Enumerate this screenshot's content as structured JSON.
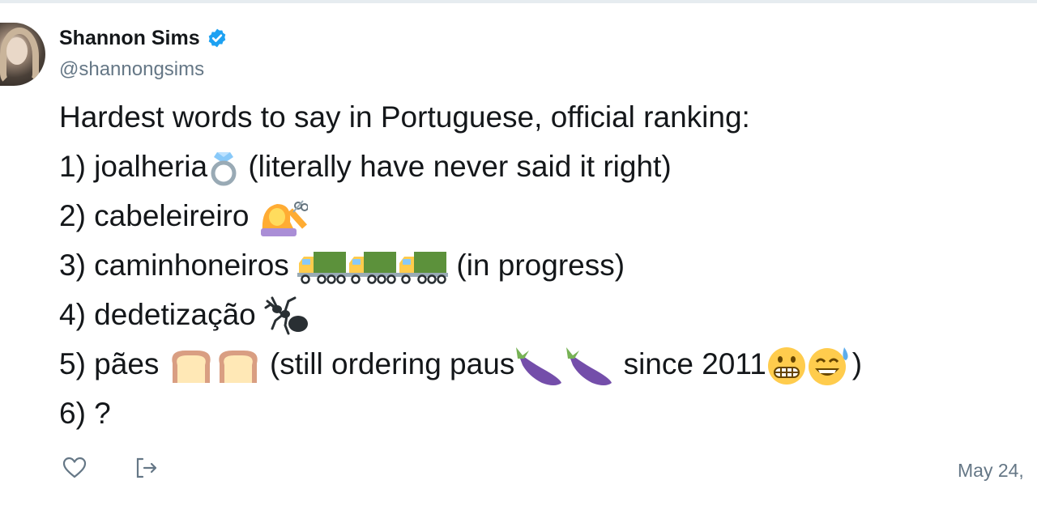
{
  "author": {
    "display_name": "Shannon Sims",
    "handle": "@shannongsims",
    "verified_icon": "verified-badge-icon",
    "avatar_icon": "profile-avatar"
  },
  "tweet": {
    "intro": "Hardest words to say in Portuguese, official ranking:",
    "items": [
      {
        "prefix": "1) joalheria",
        "suffix": " (literally have never said it right)",
        "emoji": [
          "ring-emoji"
        ]
      },
      {
        "prefix": "2) cabeleireiro ",
        "suffix": "",
        "emoji": [
          "haircut-emoji"
        ]
      },
      {
        "prefix": "3) caminhoneiros ",
        "suffix": " (in progress)",
        "emoji": [
          "truck-emoji",
          "truck-emoji",
          "truck-emoji"
        ]
      },
      {
        "prefix": "4) dedetização ",
        "suffix": "",
        "emoji": [
          "ant-emoji"
        ]
      },
      {
        "prefix": "5) pães ",
        "middle": " (still ordering paus",
        "suffix_a": " since 2011",
        "suffix": ")",
        "emoji": [
          "bread-emoji",
          "bread-emoji"
        ],
        "emoji2": [
          "eggplant-emoji",
          "eggplant-emoji"
        ],
        "emoji3": [
          "grimacing-face-emoji",
          "sweat-smile-emoji"
        ]
      },
      {
        "prefix": "6) ?",
        "suffix": "",
        "emoji": []
      }
    ]
  },
  "footer": {
    "like_icon": "heart-icon",
    "share_icon": "share-icon",
    "timestamp": "May 24,"
  },
  "colors": {
    "text": "#14171a",
    "secondary": "#657786",
    "verified": "#1da1f2",
    "divider": "#e6ecf0"
  }
}
